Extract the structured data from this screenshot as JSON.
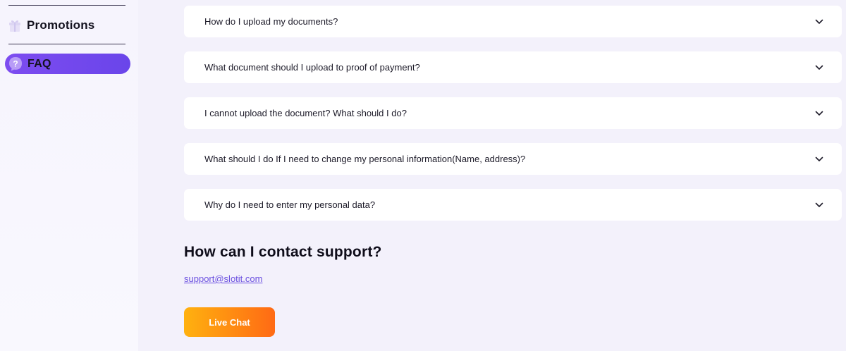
{
  "sidebar": {
    "promotions": {
      "label": "Promotions",
      "icon": "gift-icon"
    },
    "faq": {
      "label": "FAQ",
      "icon": "question-icon",
      "active": true
    }
  },
  "faq_items": [
    {
      "question": "How do I upload my documents?"
    },
    {
      "question": "What document should I upload to proof of payment?"
    },
    {
      "question": "I cannot upload the document? What should I do?"
    },
    {
      "question": "What should I do If I need to change my personal information(Name, address)?"
    },
    {
      "question": "Why do I need to enter my personal data?"
    }
  ],
  "support": {
    "title": "How can I contact support?",
    "email": "support@slotit.com",
    "live_chat_label": "Live Chat"
  },
  "colors": {
    "accent": "#7d4cf0",
    "cta_start": "#ffb10f",
    "cta_end": "#ff6a14",
    "page_bg": "#f3f1fb"
  }
}
